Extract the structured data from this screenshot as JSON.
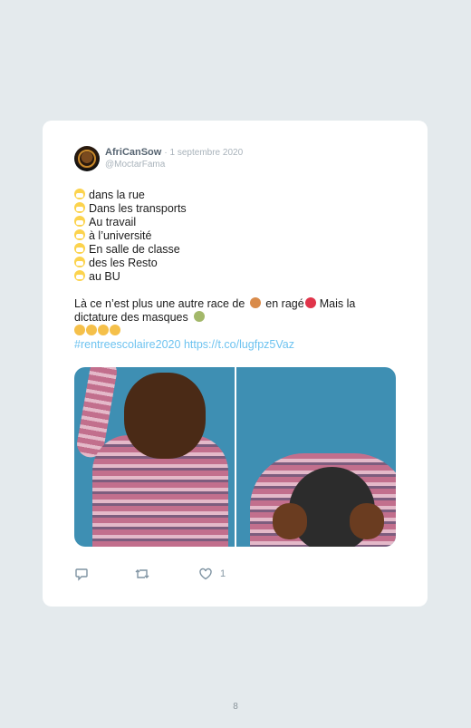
{
  "tweet": {
    "name": "AfriCanSow",
    "date": "· 1 septembre 2020",
    "handle": "@MoctarFama",
    "lines": [
      "dans la rue",
      "Dans les transports",
      "Au travail",
      "à l’université",
      "En salle de classe",
      "des les Resto",
      "au BU"
    ],
    "para1": "Là ce n’est plus une autre race de",
    "para2": "en ragé",
    "para3": "Mais la",
    "para4": "dictature des masques",
    "hashtag": "#rentreescolaire2020",
    "url": "https://t.co/lugfpz5Vaz"
  },
  "actions": {
    "like_count": "1"
  },
  "page": {
    "number": "8"
  },
  "colors": {
    "background": "#e4eaed",
    "card": "#ffffff",
    "link": "#6ec3f0",
    "name": "#556370",
    "meta": "#a9b3bb"
  },
  "icons": [
    "reply-icon",
    "retweet-icon",
    "heart-icon",
    "mask-emoji",
    "dog-emoji",
    "angry-emoji",
    "microbe-emoji"
  ]
}
